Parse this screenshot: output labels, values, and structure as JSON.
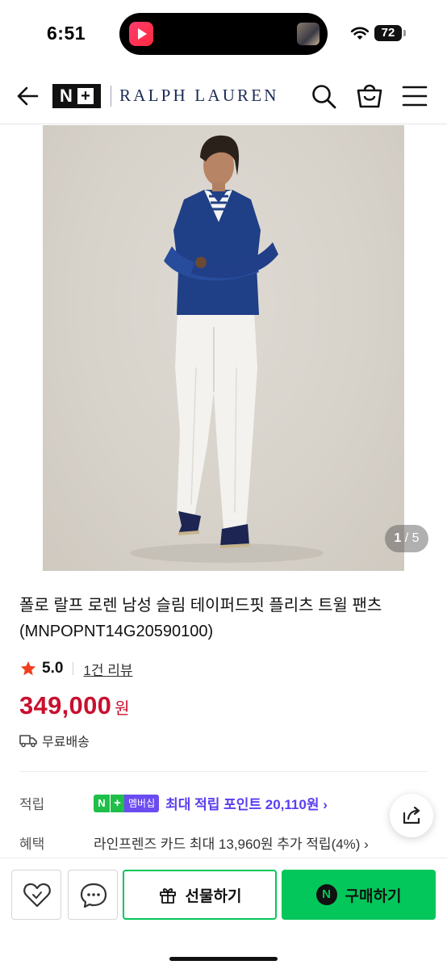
{
  "status_bar": {
    "time": "6:51",
    "battery": "72"
  },
  "header": {
    "back_icon": "back-arrow-icon",
    "logo_n": "N",
    "logo_plus": "+",
    "brand": "RALPH LAUREN",
    "icons": [
      "search-icon",
      "shopping-bag-icon",
      "menu-icon"
    ]
  },
  "gallery": {
    "current": "1",
    "separator": " / ",
    "total": "5"
  },
  "product": {
    "title": "폴로 랄프 로렌 남성 슬림 테이퍼드핏 플리츠 트윌 팬츠 (MNPOPNT14G20590100)",
    "rating": "5.0",
    "review_link": "1건 리뷰",
    "price": "349,000",
    "price_unit": "원",
    "shipping": "무료배송",
    "price_color": "#c8102e"
  },
  "benefits": {
    "points_label": "적립",
    "badge_n": "N",
    "badge_plus": "+",
    "badge_text": "멤버십",
    "points_text": "최대 적립 포인트 20,110원 ›",
    "benefit_label": "혜택",
    "benefit_text": "라인프렌즈 카드 최대 13,960원 추가 적립(4%) ›"
  },
  "bottom_bar": {
    "gift_label": "선물하기",
    "buy_label": "구매하기",
    "npay_letter": "N",
    "accent_color": "#03c75a"
  }
}
